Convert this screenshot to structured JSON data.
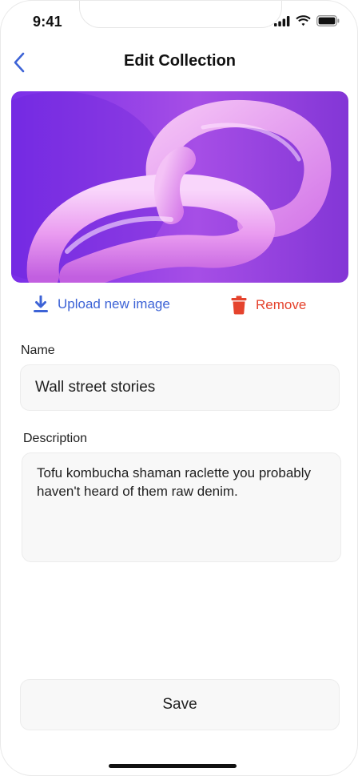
{
  "status_bar": {
    "time": "9:41"
  },
  "header": {
    "title": "Edit Collection"
  },
  "cover": {
    "alt": "pink chain link"
  },
  "actions": {
    "upload_label": "Upload new image",
    "remove_label": "Remove"
  },
  "form": {
    "name_label": "Name",
    "name_value": "Wall street stories",
    "description_label": "Description",
    "description_value": "Tofu kombucha shaman raclette you probably haven't heard of them raw denim."
  },
  "save_label": "Save",
  "colors": {
    "accent": "#3d63d6",
    "danger": "#e5432d",
    "image_bg": "#8a3fe0"
  }
}
